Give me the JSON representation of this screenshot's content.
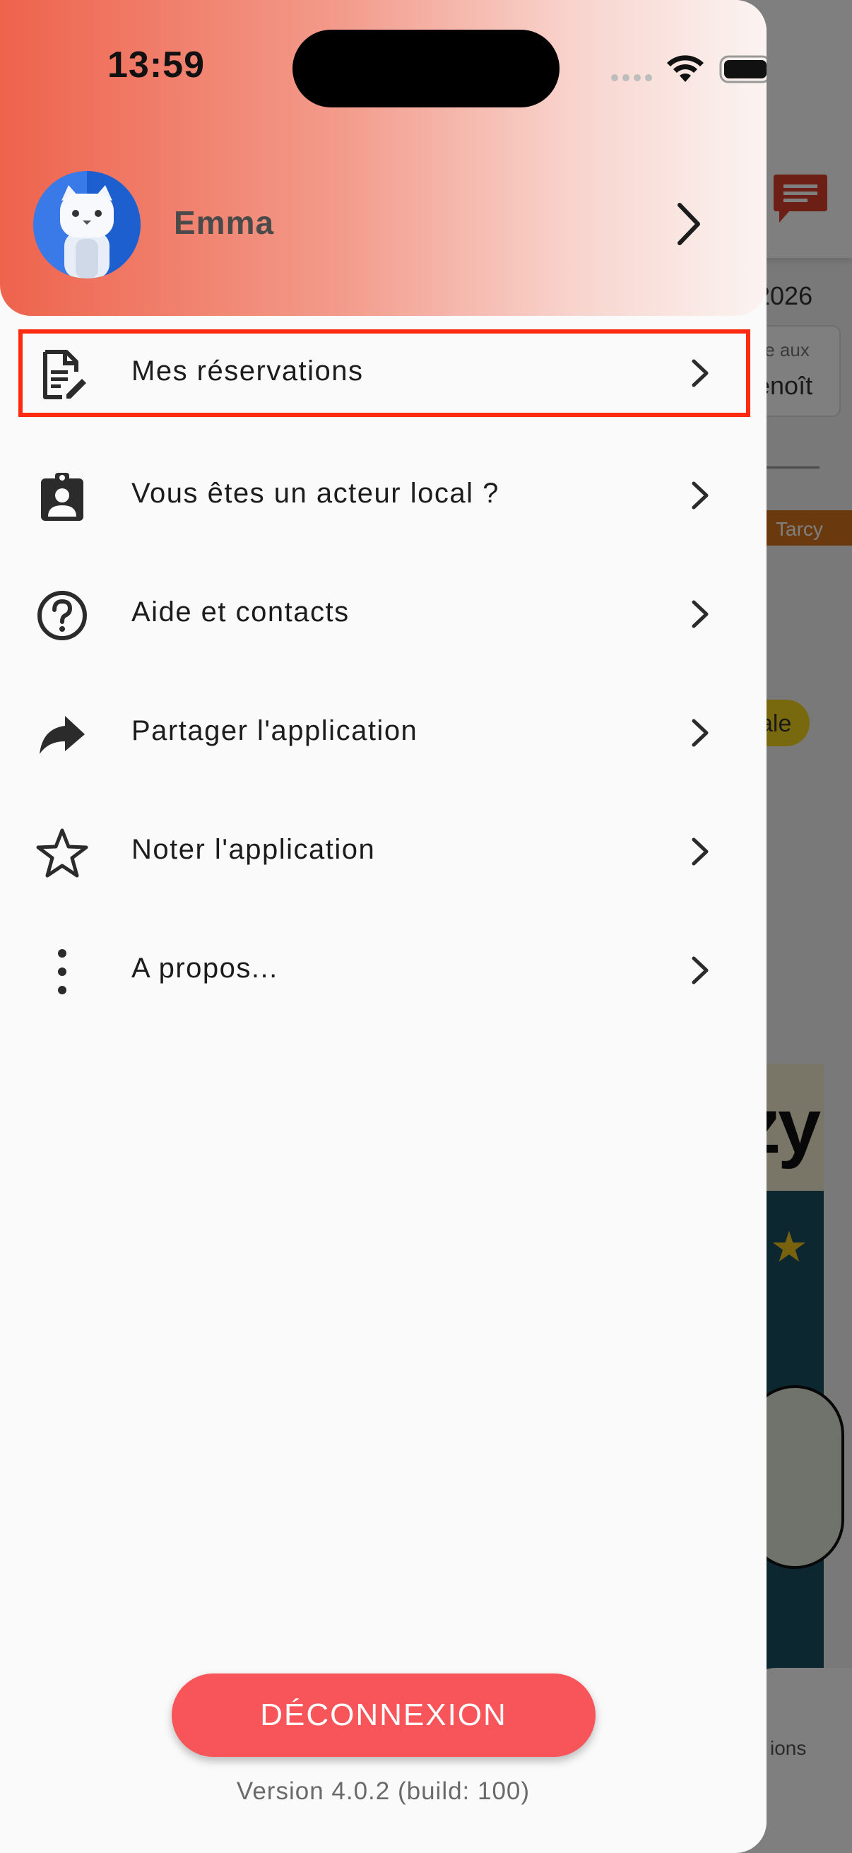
{
  "status_bar": {
    "time": "13:59"
  },
  "profile": {
    "name": "Emma"
  },
  "menu": {
    "items": [
      {
        "label": "Mes réservations",
        "icon": "document-edit-icon",
        "highlighted": true
      },
      {
        "label": "Vous êtes un acteur local ?",
        "icon": "badge-person-icon"
      },
      {
        "label": "Aide et contacts",
        "icon": "help-circle-icon"
      },
      {
        "label": "Partager l'application",
        "icon": "share-arrow-icon"
      },
      {
        "label": "Noter l'application",
        "icon": "star-outline-icon"
      },
      {
        "label": "A propos...",
        "icon": "more-vertical-icon"
      }
    ]
  },
  "logout": {
    "label": "DÉCONNEXION"
  },
  "version": {
    "text": "Version 4.0.2 (build: 100)"
  },
  "background_app": {
    "year": "2026",
    "card_line1": "te aux",
    "card_line2": "enoît",
    "band_text": "Tarcy",
    "pill_text": "ale",
    "poster_text": "zy",
    "nav_text": "ions"
  },
  "colors": {
    "header_start": "#ee634c",
    "header_end": "#fbf4f2",
    "logout_button": "#f8555a",
    "highlight_border": "#ff2a10",
    "avatar_bg": "#2f6fe0"
  }
}
